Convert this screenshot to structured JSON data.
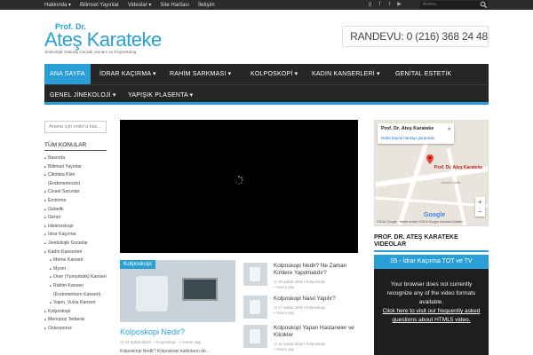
{
  "topbar": {
    "links": [
      "Hakkında ▾",
      "Bilimsel Yayınlar",
      "Videolar ▾",
      "Site Haritası",
      "İletişim"
    ],
    "search_placeholder": "Arama..."
  },
  "logo": {
    "pre": "Prof. Dr.",
    "name_first": "Ateş",
    "name_last": "Karateke",
    "sub": "Jinekolojik Onkoloji Cerrahi Uzmanı ve Ürojinekolog"
  },
  "randevu": {
    "text": "RANDEVU: 0 (216) 368 24 48"
  },
  "nav": {
    "items": [
      "ANA SAYFA",
      "İDRAR KAÇIRMA ▾",
      "RAHİM SARKMASI ▾",
      "KOLPOSKOPİ ▾",
      "KADIN KANSERLERİ ▾",
      "GENİTAL ESTETİK",
      "GENEL JİNEKOLOJİ ▾",
      "YAPIŞIK PLASENTA ▾"
    ]
  },
  "sidebar": {
    "search_placeholder": "Arama için enter'a bas...",
    "heading": "TÜM KONULAR",
    "items": [
      {
        "label": "Basında",
        "sub": false
      },
      {
        "label": "Bilimsel Yayınlar",
        "sub": false
      },
      {
        "label": "Çikolata Kisti (Endometriozis)",
        "sub": false
      },
      {
        "label": "Cinsel Sorunlar",
        "sub": false
      },
      {
        "label": "Emzirme",
        "sub": false
      },
      {
        "label": "Gebelik",
        "sub": false
      },
      {
        "label": "Genel",
        "sub": false
      },
      {
        "label": "Histeroskopi",
        "sub": false
      },
      {
        "label": "İdrar Kaçırma",
        "sub": false
      },
      {
        "label": "Jinekolojik Sorunlar",
        "sub": false
      },
      {
        "label": "Kadın Kanserleri",
        "sub": false
      },
      {
        "label": "Meme Kanseri",
        "sub": true
      },
      {
        "label": "Myom",
        "sub": true
      },
      {
        "label": "Over (Yumurtalık) Kanseri",
        "sub": true
      },
      {
        "label": "Rahim Kanseri (Endometrium Kanseri)",
        "sub": true
      },
      {
        "label": "Vajen, Vulva Kanseri",
        "sub": true
      },
      {
        "label": "Kolposkopi",
        "sub": false
      },
      {
        "label": "Menopoz Tedavisi",
        "sub": false
      },
      {
        "label": "Osteoporoz",
        "sub": false
      }
    ]
  },
  "featured": {
    "tag": "Kolposkopi",
    "title": "Kolposkopi Nedir?",
    "date": "23 Şubat 2016",
    "category": "Kolposkopi",
    "comments": "Yorum yap",
    "excerpt": "Kolposkopi Nedir? Kolposkopi kadınların de..."
  },
  "posts": [
    {
      "title": "Kolposkopi Nedir? Ne Zaman Kimlere Yapılmalıdır?",
      "date": "18 Şubat 2016",
      "category": "Kolposkopi",
      "comments": "Yorum yap"
    },
    {
      "title": "Kolposkopi Nasıl Yapılır?",
      "date": "17 Şubat 2016",
      "category": "Kolposkopi",
      "comments": "Yorum yap"
    },
    {
      "title": "Kolposkopi Yapan Hastaneler ve Klinikler",
      "date": "16 Şubat 2016",
      "category": "Kolposkopi",
      "comments": "Yorum yap"
    }
  ],
  "map": {
    "card_title": "Prof. Dr. Ateş Karateke",
    "card_link": "Daha büyük haritayı görüntüle",
    "pin_label": "Prof. Dr. Ateş Karateke",
    "street": "Ahmet Vefik...",
    "attribution": "©2016 Google · Harita verileri ©2016 Google    Kullanım Şartları"
  },
  "videos": {
    "heading": "PROF. DR. ATEŞ KARATEKE VIDEOLAR",
    "title": "05 - İdrar Kaçırma TOT ve TV",
    "message": "Your browser does not currently recognize any of the video formats available.",
    "link": "Click here to visit our frequently asked questions about HTML5 video."
  }
}
